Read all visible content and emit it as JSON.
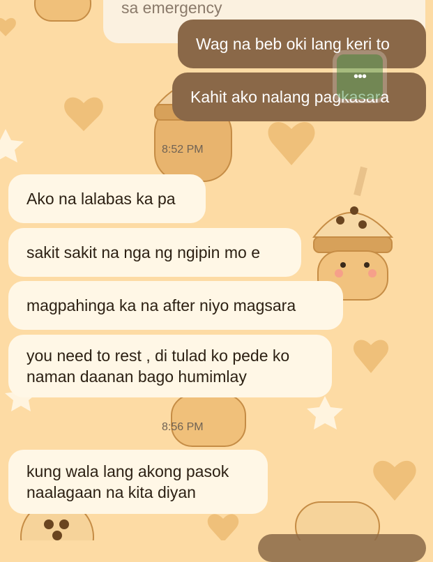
{
  "chat": {
    "partial_top": "sa emergency",
    "outgoing": [
      "Wag na beb oki lang keri to",
      "Kahit ako nalang pagkasara"
    ],
    "timestamp_1": "8:52 PM",
    "incoming_1": [
      "Ako na lalabas ka pa",
      "sakit sakit na nga ng ngipin mo e",
      "magpahinga ka na after niyo magsara",
      "you need to rest , di tulad ko pede ko naman daanan bago humimlay"
    ],
    "timestamp_2": "8:56 PM",
    "incoming_2": [
      "kung wala lang akong pasok naalagaan na kita diyan"
    ]
  },
  "overlay": {
    "more_button_icon": "more-dots-icon",
    "more_glyph": "•••"
  },
  "colors": {
    "background": "#fddba4",
    "incoming_bubble": "#fff7e6",
    "outgoing_bubble": "#8a6848",
    "overlay_button": "#5fa05f"
  }
}
